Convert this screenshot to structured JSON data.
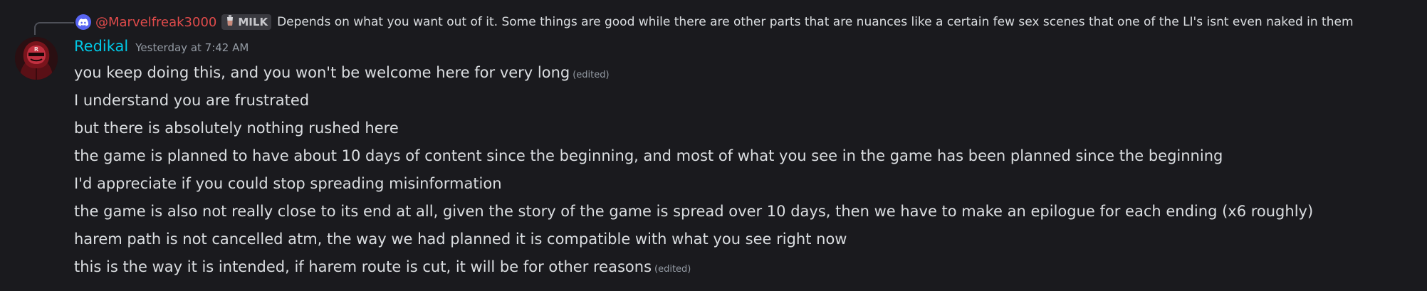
{
  "reply": {
    "author": "@Marvelfreak3000",
    "role_tag": "MILK",
    "text": "Depends on what you want out of it. Some things are good while there are other parts that are nuances like a certain few sex scenes that one of the LI's isnt even naked in them"
  },
  "message": {
    "username": "Redikal",
    "timestamp": "Yesterday at 7:42 AM",
    "lines": [
      {
        "text": "you keep doing this, and you won't be welcome here for very long",
        "edited": "(edited)"
      },
      {
        "text": "I understand you are frustrated",
        "edited": null
      },
      {
        "text": "but there is absolutely nothing rushed here",
        "edited": null
      },
      {
        "text": "the game is planned to have about 10 days of content since the beginning, and most of what you see in the game has been planned since the beginning",
        "edited": null
      },
      {
        "text": "I'd appreciate if you could stop spreading misinformation",
        "edited": null
      },
      {
        "text": "the game is also not really close to its end at all, given the story of the game is spread over 10 days, then we have to make an epilogue for each ending (x6 roughly)",
        "edited": null
      },
      {
        "text": "harem path is not cancelled atm, the way we had planned it is compatible with what you see right now",
        "edited": null
      },
      {
        "text": "this is the way it is intended, if harem route is cut, it will be for other reasons",
        "edited": "(edited)"
      }
    ]
  },
  "icons": {
    "reply_avatar": "discord-logo-icon",
    "role_tag": "milk-glass-icon",
    "avatar": "user-avatar-red-hooded-figure"
  },
  "colors": {
    "background": "#1a1a1e",
    "reply_author": "#e04b4b",
    "username": "#00c8e6",
    "timestamp": "#949ba4",
    "text": "#dbdee1"
  }
}
